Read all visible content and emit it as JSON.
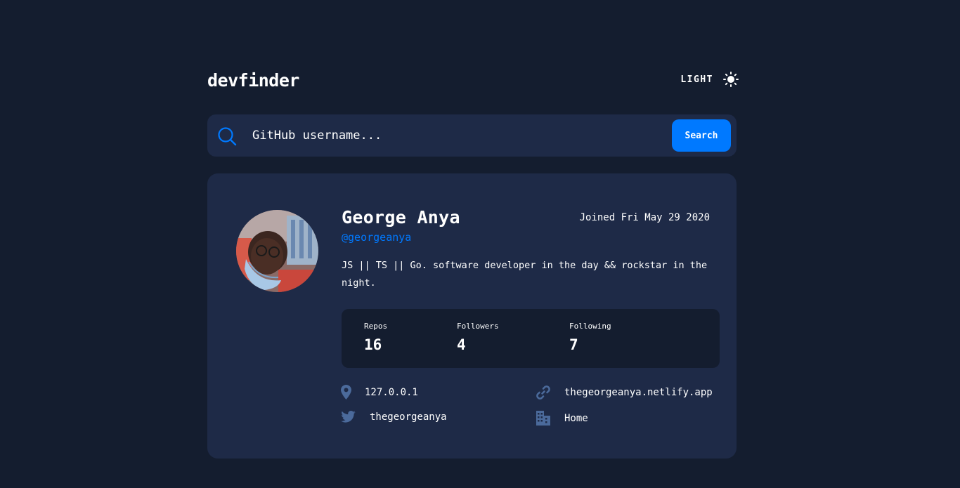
{
  "header": {
    "logo": "devfinder",
    "theme_label": "LIGHT",
    "theme_icon": "sun-icon"
  },
  "search": {
    "placeholder": "GitHub username...",
    "value": "",
    "button_label": "Search",
    "icon": "search-icon"
  },
  "profile": {
    "name": "George Anya",
    "login": "@georgeanya",
    "joined": "Joined Fri May 29 2020",
    "bio": "JS || TS || Go. software developer in the day && rockstar in the night.",
    "stats": {
      "repos_label": "Repos",
      "repos": "16",
      "followers_label": "Followers",
      "followers": "4",
      "following_label": "Following",
      "following": "7"
    },
    "links": {
      "location": "127.0.0.1",
      "website": "thegeorgeanya.netlify.app",
      "twitter": "thegeorgeanya",
      "company": "Home"
    }
  },
  "colors": {
    "background": "#141d2f",
    "card": "#1e2a47",
    "accent": "#0079ff",
    "icon_muted": "#4b6a9b",
    "text": "#ffffff"
  }
}
